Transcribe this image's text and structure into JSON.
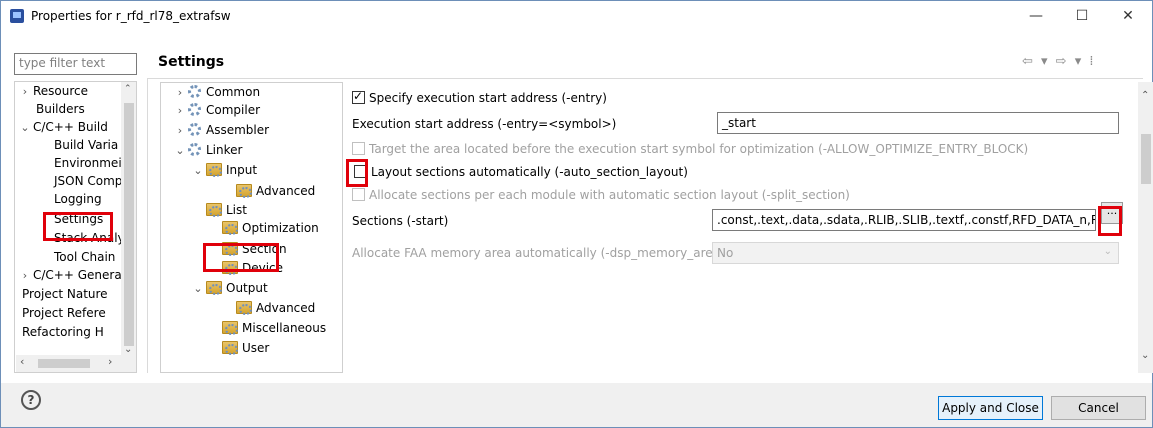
{
  "window": {
    "title": "Properties for r_rfd_rl78_extrafsw",
    "minimize": "—",
    "maximize": "☐",
    "close": "✕"
  },
  "filter": {
    "placeholder": "type filter text"
  },
  "left_tree": [
    {
      "label": "Resource",
      "chev": "›"
    },
    {
      "label": "Builders",
      "chev": ""
    },
    {
      "label": "C/C++ Build",
      "chev": "⌄"
    },
    {
      "label": "Build Varia",
      "chev": ""
    },
    {
      "label": "Environmei",
      "chev": ""
    },
    {
      "label": "JSON Comp",
      "chev": ""
    },
    {
      "label": "Logging",
      "chev": ""
    },
    {
      "label": "Settings",
      "chev": ""
    },
    {
      "label": "Stack Analy",
      "chev": ""
    },
    {
      "label": "Tool Chain",
      "chev": ""
    },
    {
      "label": "C/C++ Genera",
      "chev": "›"
    },
    {
      "label": "Project Nature",
      "chev": ""
    },
    {
      "label": "Project Refere",
      "chev": ""
    },
    {
      "label": "Refactoring H",
      "chev": ""
    }
  ],
  "heading": "Settings",
  "nav_icons": "⇦ ▾ ⇨ ▾ ⁞",
  "tool_tree": [
    {
      "label": "Common",
      "chev": "›",
      "icon": "gear"
    },
    {
      "label": "Compiler",
      "chev": "›",
      "icon": "gear"
    },
    {
      "label": "Assembler",
      "chev": "›",
      "icon": "gear"
    },
    {
      "label": "Linker",
      "chev": "⌄",
      "icon": "gear"
    },
    {
      "label": "Input",
      "chev": "⌄",
      "icon": "folder"
    },
    {
      "label": "Advanced",
      "chev": "",
      "icon": "folder"
    },
    {
      "label": "List",
      "chev": "",
      "icon": "folder"
    },
    {
      "label": "Optimization",
      "chev": "",
      "icon": "folder"
    },
    {
      "label": "Section",
      "chev": "",
      "icon": "folder"
    },
    {
      "label": "Device",
      "chev": "",
      "icon": "folder"
    },
    {
      "label": "Output",
      "chev": "⌄",
      "icon": "folder"
    },
    {
      "label": "Advanced",
      "chev": "",
      "icon": "folder"
    },
    {
      "label": "Miscellaneous",
      "chev": "",
      "icon": "folder"
    },
    {
      "label": "User",
      "chev": "",
      "icon": "folder"
    }
  ],
  "options": {
    "specify_entry": "Specify execution start address (-entry)",
    "entry_label": "Execution start address (-entry=<symbol>)",
    "entry_value": "_start",
    "target_area": "Target the area located before the execution start symbol for optimization (-ALLOW_OPTIMIZE_ENTRY_BLOCK)",
    "auto_layout": "Layout sections automatically (-auto_section_layout)",
    "split_section": "Allocate sections per each module with automatic section layout (-split_section)",
    "sections_label": "Sections (-start)",
    "sections_value": ".const,.text,.data,.sdata,.RLIB,.SLIB,.textf,.constf,RFD_DATA_n,RFD_Cl",
    "ellipsis": "...",
    "faa_label": "Allocate FAA memory area automatically (-dsp_memory_area)",
    "faa_value": "No"
  },
  "buttons": {
    "apply_close": "Apply and Close",
    "cancel": "Cancel",
    "help": "?"
  },
  "colors": {
    "highlight": "#e0000a",
    "default_button_border": "#0078d7"
  }
}
